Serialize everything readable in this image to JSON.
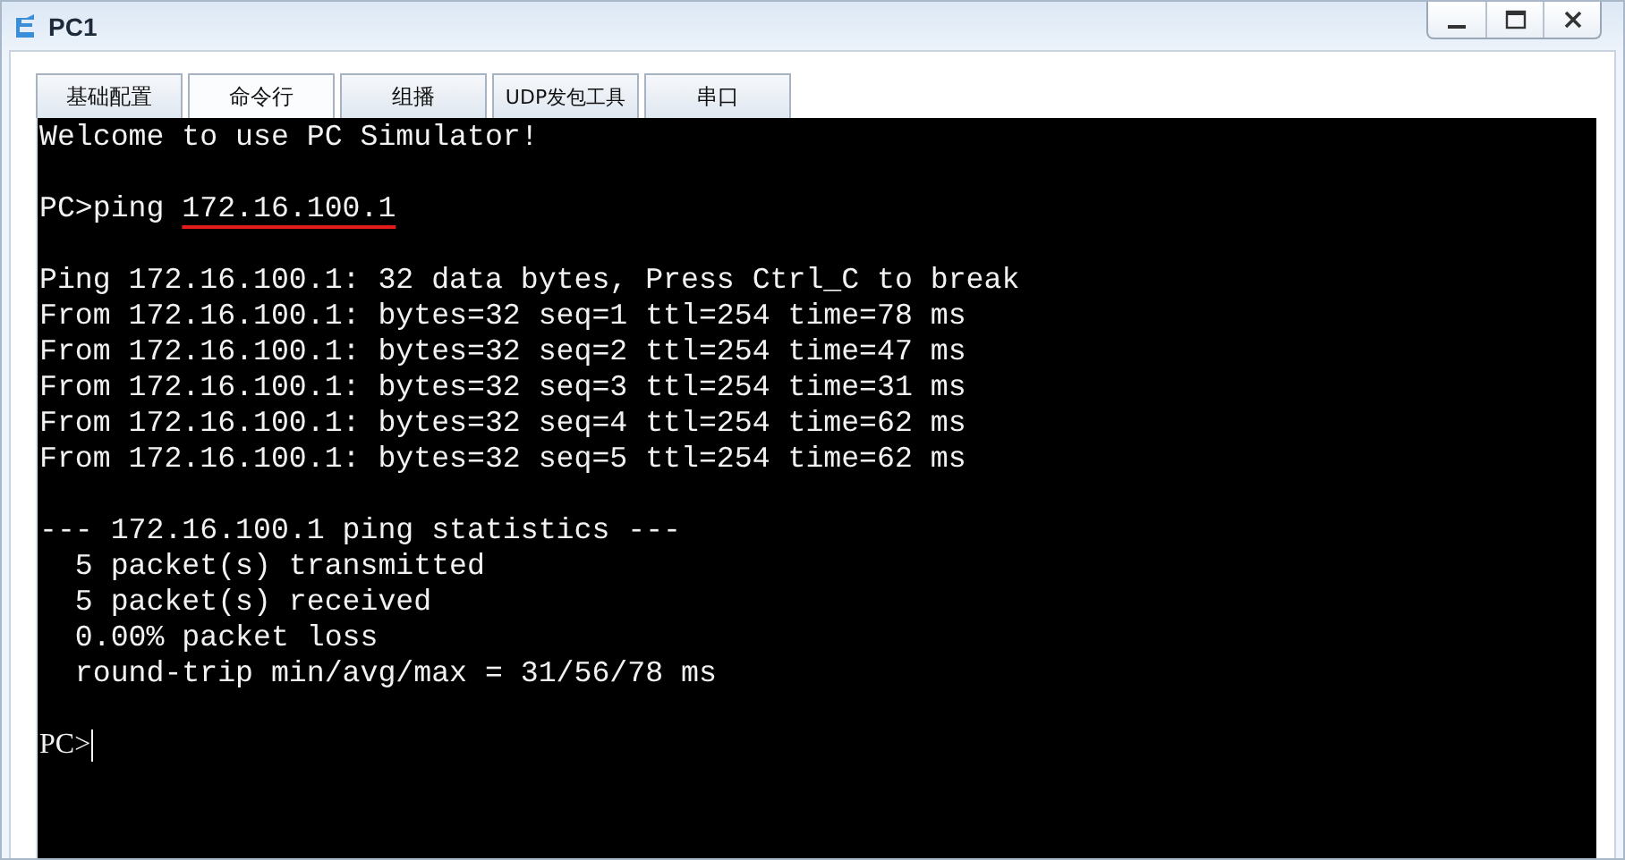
{
  "window": {
    "title": "PC1"
  },
  "tabs": [
    {
      "label": "基础配置",
      "selected": false
    },
    {
      "label": "命令行",
      "selected": true
    },
    {
      "label": "组播",
      "selected": false
    },
    {
      "label": "UDP发包工具",
      "selected": false
    },
    {
      "label": "串口",
      "selected": false
    }
  ],
  "terminal": {
    "welcome": "Welcome to use PC Simulator!",
    "command": {
      "prompt": "PC>ping ",
      "argument": "172.16.100.1",
      "underlined": true
    },
    "ping_output": [
      "Ping 172.16.100.1: 32 data bytes, Press Ctrl_C to break",
      "From 172.16.100.1: bytes=32 seq=1 ttl=254 time=78 ms",
      "From 172.16.100.1: bytes=32 seq=2 ttl=254 time=47 ms",
      "From 172.16.100.1: bytes=32 seq=3 ttl=254 time=31 ms",
      "From 172.16.100.1: bytes=32 seq=4 ttl=254 time=62 ms",
      "From 172.16.100.1: bytes=32 seq=5 ttl=254 time=62 ms"
    ],
    "statistics": [
      "--- 172.16.100.1 ping statistics ---",
      "  5 packet(s) transmitted",
      "  5 packet(s) received",
      "  0.00% packet loss",
      "  round-trip min/avg/max = 31/56/78 ms"
    ],
    "prompt": "PC>"
  }
}
